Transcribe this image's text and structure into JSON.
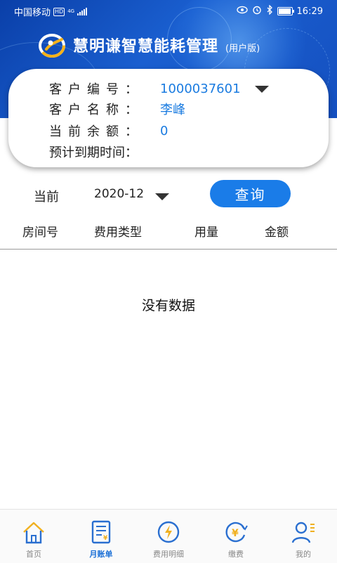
{
  "status_bar": {
    "carrier": "中国移动",
    "hd": "HD",
    "network": "4G",
    "time": "16:29",
    "battery_level": 0.85
  },
  "app": {
    "title": "慧明谦智慧能耗管理",
    "subtitle": "(用户版)"
  },
  "customer_card": {
    "id_label": "客户编号：",
    "id_value": "1000037601",
    "name_label": "客户名称：",
    "name_value": "李峰",
    "balance_label": "当前余额：",
    "balance_value": "0",
    "expiry_label": "预计到期时间："
  },
  "filter": {
    "period_label": "当前",
    "month_value": "2020-12",
    "query_label": "查询"
  },
  "table": {
    "columns": [
      "房间号",
      "费用类型",
      "用量",
      "金额"
    ],
    "empty_text": "没有数据"
  },
  "bottom_nav": [
    {
      "label": "首页",
      "icon": "home-icon",
      "active": false
    },
    {
      "label": "月账单",
      "icon": "bill-icon",
      "active": true
    },
    {
      "label": "费用明细",
      "icon": "lightning-icon",
      "active": false
    },
    {
      "label": "缴费",
      "icon": "yuan-payment-icon",
      "active": false
    },
    {
      "label": "我的",
      "icon": "user-icon",
      "active": false
    }
  ],
  "colors": {
    "header_blue": "#1550c0",
    "accent_blue": "#1a7ce8",
    "value_blue": "#1a7be0",
    "nav_active": "#1a6fd6"
  }
}
